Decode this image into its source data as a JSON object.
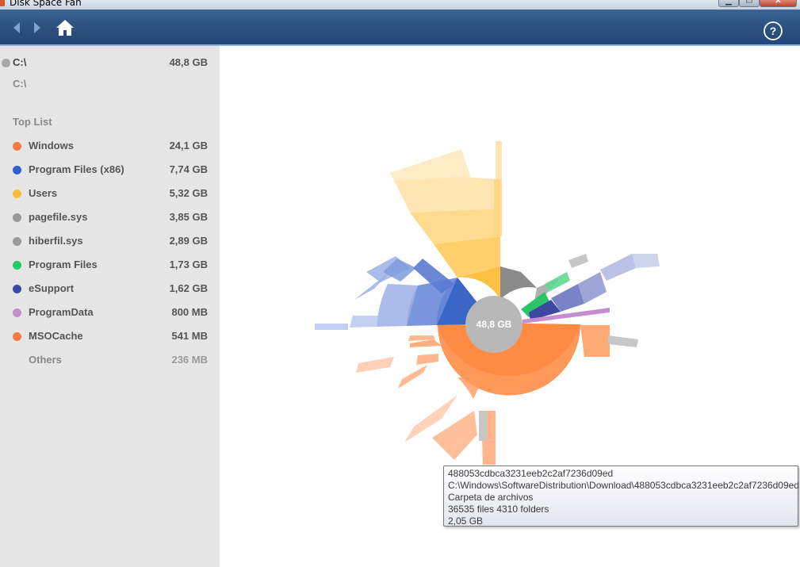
{
  "window": {
    "title": "Disk Space Fan"
  },
  "toolbar": {
    "back": "back",
    "forward": "forward",
    "home": "home",
    "help": "help"
  },
  "drive": {
    "label": "C:\\",
    "size": "48,8 GB",
    "path": "C:\\"
  },
  "top_list": {
    "title": "Top List",
    "items": [
      {
        "label": "Windows",
        "size": "24,1 GB",
        "color": "#f47c3c"
      },
      {
        "label": "Program Files (x86)",
        "size": "7,74 GB",
        "color": "#2f5fd0"
      },
      {
        "label": "Users",
        "size": "5,32 GB",
        "color": "#f7be3a"
      },
      {
        "label": "pagefile.sys",
        "size": "3,85 GB",
        "color": "#9a9a9a"
      },
      {
        "label": "hiberfil.sys",
        "size": "2,89 GB",
        "color": "#9a9a9a"
      },
      {
        "label": "Program Files",
        "size": "1,73 GB",
        "color": "#22cc66"
      },
      {
        "label": "eSupport",
        "size": "1,62 GB",
        "color": "#3b4aa8"
      },
      {
        "label": "ProgramData",
        "size": "800 MB",
        "color": "#c48ed0"
      },
      {
        "label": "MSOCache",
        "size": "541 MB",
        "color": "#f47c3c"
      }
    ],
    "others": {
      "label": "Others",
      "size": "236 MB"
    }
  },
  "chart": {
    "center_label": "48,8 GB"
  },
  "tooltip": {
    "name": "488053cdbca3231eeb2c2af7236d09ed",
    "path": "C:\\Windows\\SoftwareDistribution\\Download\\488053cdbca3231eeb2c2af7236d09ed",
    "type": "Carpeta de archivos",
    "counts": "36535 files  4310 folders",
    "size": "2,05 GB"
  }
}
